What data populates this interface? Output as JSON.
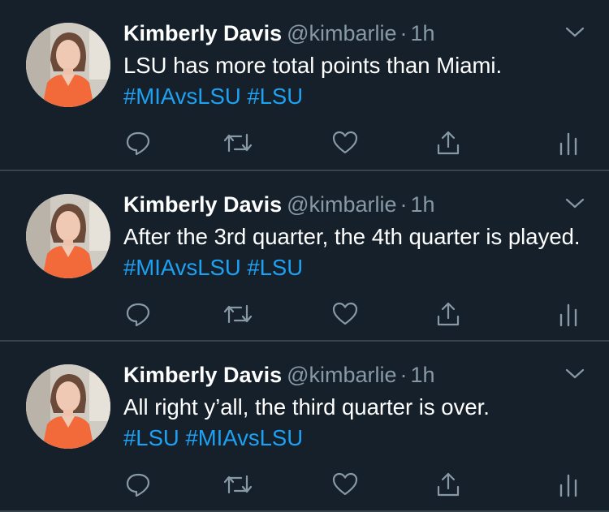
{
  "tweets": [
    {
      "name": "Kimberly Davis",
      "handle": "@kimbarlie",
      "separator": "·",
      "time": "1h",
      "text": "LSU has more total points than Miami.",
      "hashtags": [
        "#MIAvsLSU",
        "#LSU"
      ]
    },
    {
      "name": "Kimberly Davis",
      "handle": "@kimbarlie",
      "separator": "·",
      "time": "1h",
      "text": "After the 3rd quarter, the 4th quarter is played.",
      "hashtags": [
        "#MIAvsLSU",
        "#LSU"
      ]
    },
    {
      "name": "Kimberly Davis",
      "handle": "@kimbarlie",
      "separator": "·",
      "time": "1h",
      "text": "All right y’all, the third quarter is over.",
      "hashtags": [
        "#LSU",
        "#MIAvsLSU"
      ]
    }
  ],
  "icons": {
    "reply": "reply-icon",
    "retweet": "retweet-icon",
    "like": "heart-icon",
    "share": "share-icon",
    "analytics": "analytics-icon",
    "more": "chevron-down-icon"
  },
  "colors": {
    "background": "#15202b",
    "divider": "#38444d",
    "name": "#ffffff",
    "secondary": "#8899a6",
    "hashtag": "#1da1f2",
    "icon": "#8899a6"
  }
}
